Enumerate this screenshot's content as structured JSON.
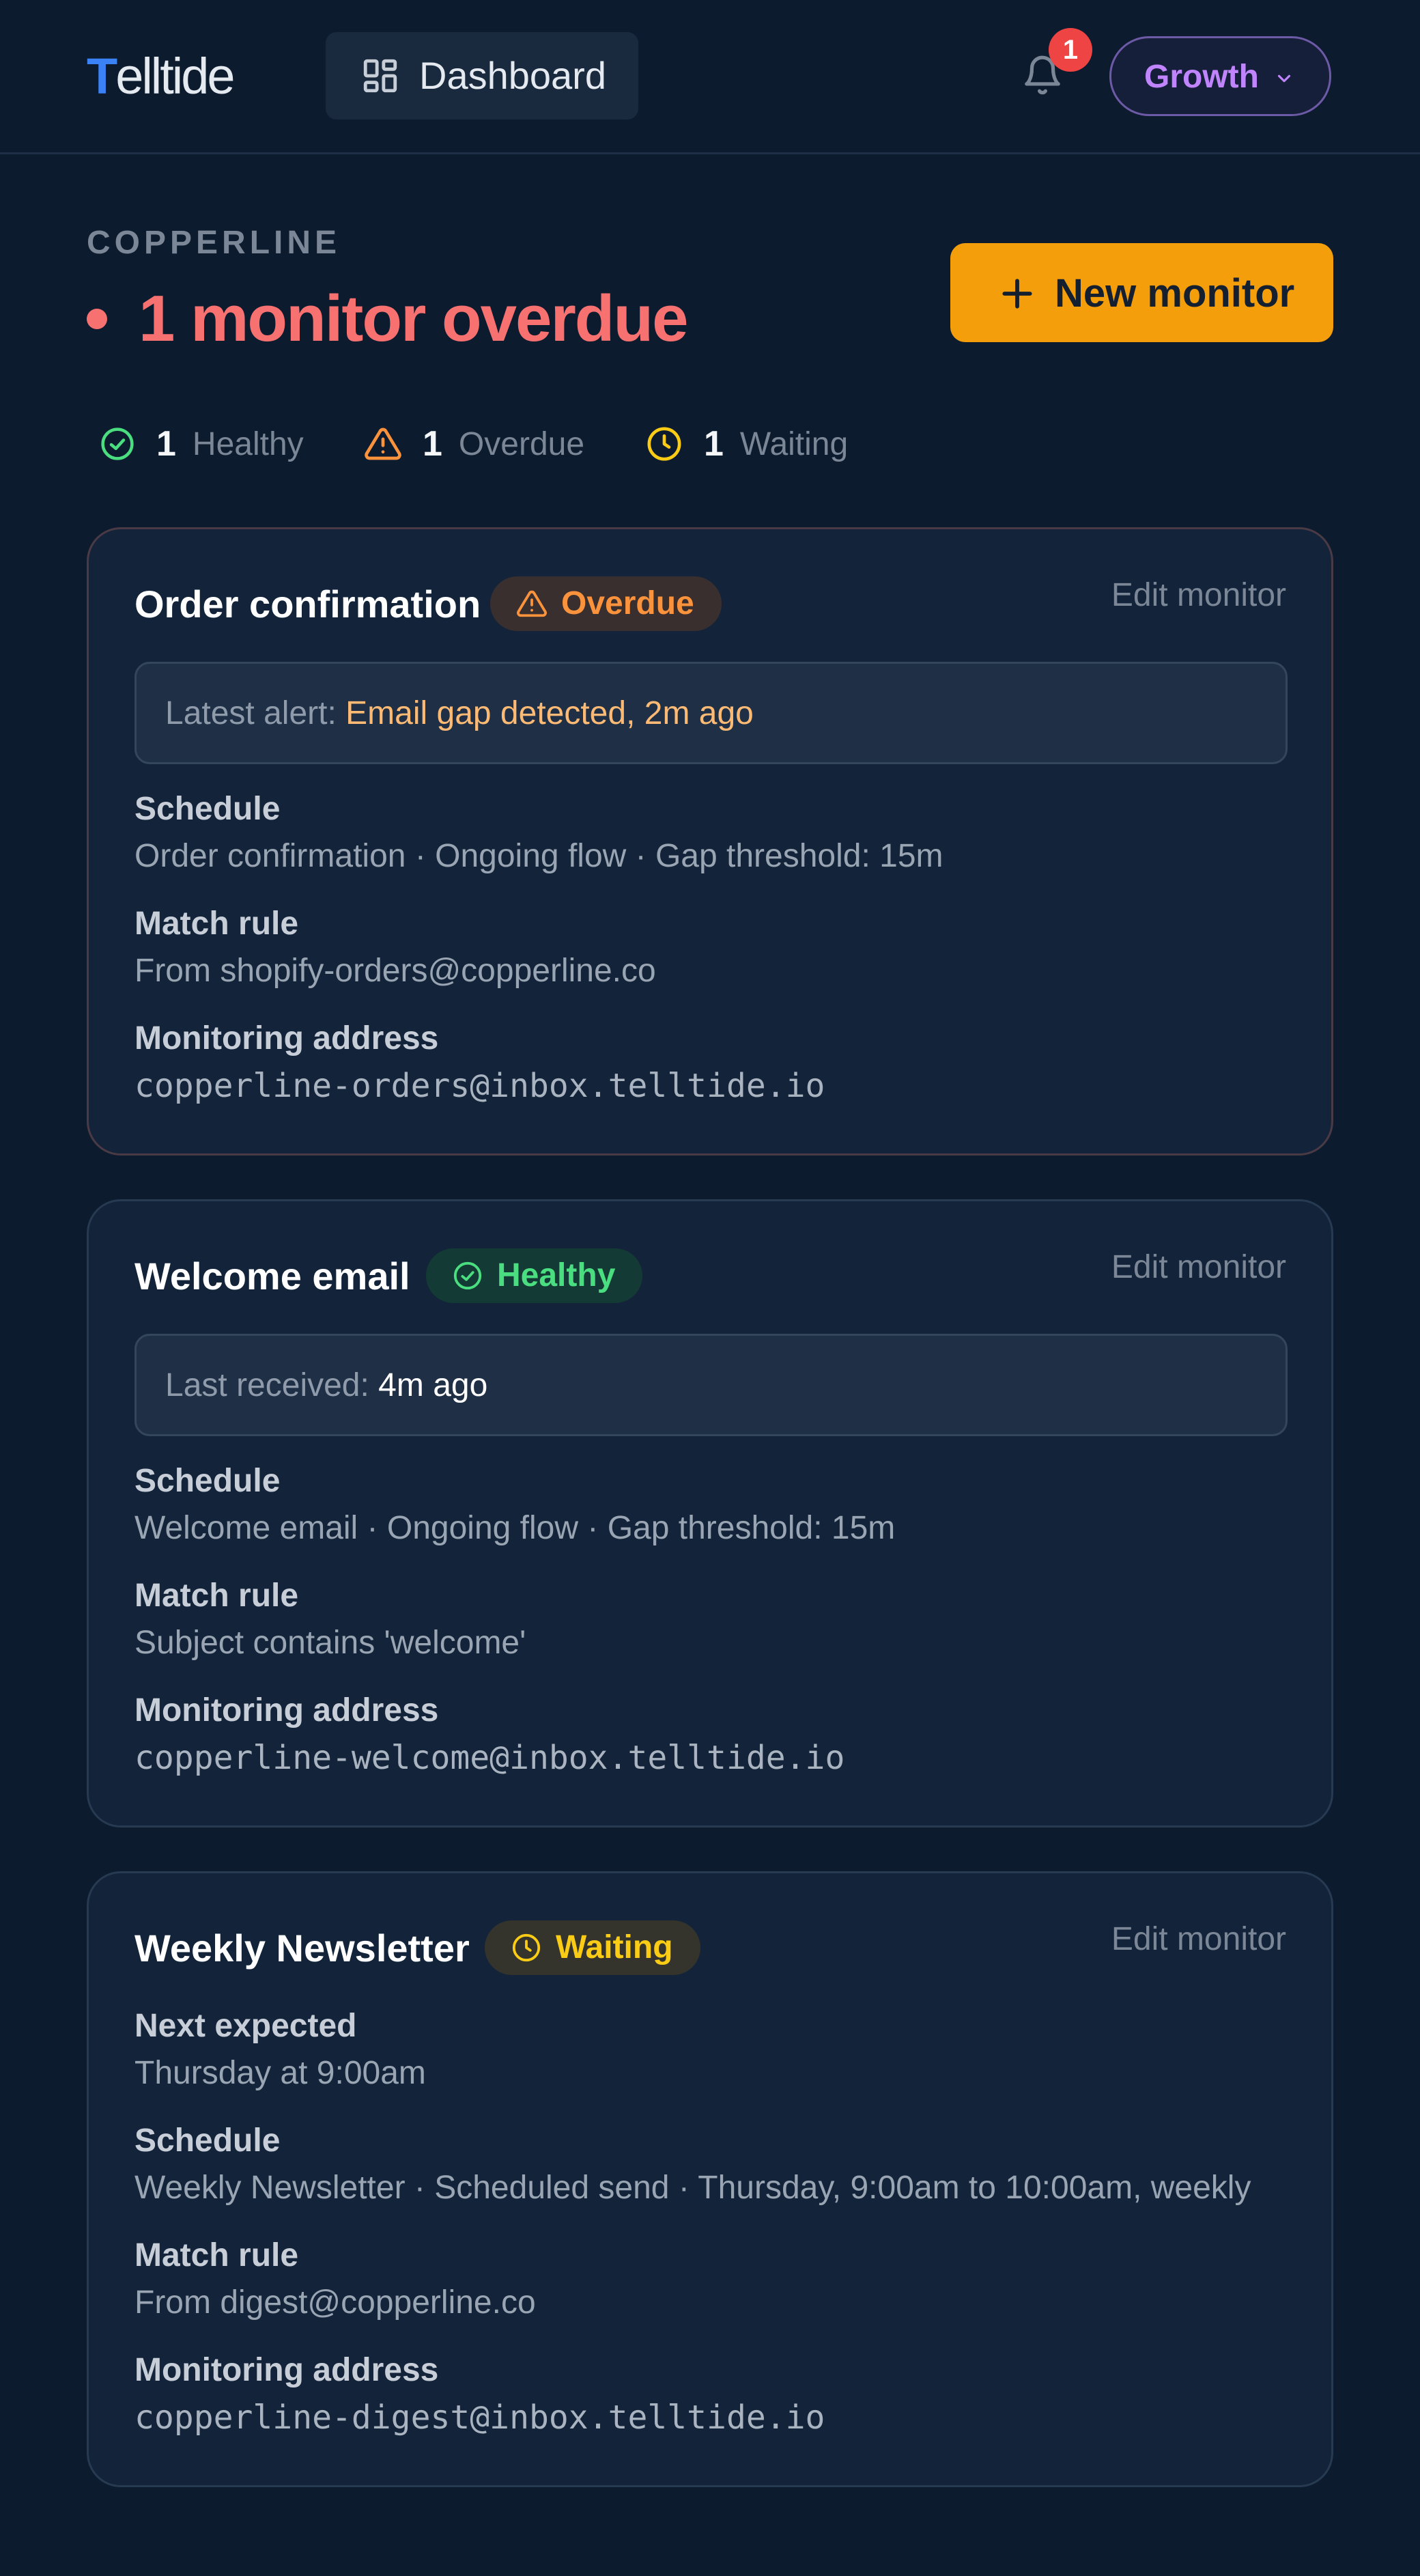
{
  "app": {
    "logo_first": "T",
    "logo_rest": "elltide"
  },
  "nav": {
    "dashboard_label": "Dashboard"
  },
  "notifications": {
    "count": "1"
  },
  "plan": {
    "label": "Growth"
  },
  "header": {
    "org": "COPPERLINE",
    "headline": "1 monitor overdue",
    "new_button": "New monitor"
  },
  "stats": {
    "healthy": {
      "count": "1",
      "label": "Healthy"
    },
    "overdue": {
      "count": "1",
      "label": "Overdue"
    },
    "waiting": {
      "count": "1",
      "label": "Waiting"
    }
  },
  "colors": {
    "healthy": "#4ade80",
    "overdue": "#fb923c",
    "waiting": "#facc15",
    "danger": "#f87171",
    "accent": "#f59e0b"
  },
  "monitors": [
    {
      "title": "Order confirmation",
      "status": "Overdue",
      "edit": "Edit monitor",
      "info_prefix": "Latest alert: ",
      "info_value": "Email gap detected, 2m ago",
      "schedule_label": "Schedule",
      "schedule": "Order confirmation · Ongoing flow · Gap threshold: 15m",
      "match_label": "Match rule",
      "match": "From shopify-orders@copperline.co",
      "address_label": "Monitoring address",
      "address": "copperline-orders@inbox.telltide.io"
    },
    {
      "title": "Welcome email",
      "status": "Healthy",
      "edit": "Edit monitor",
      "info_prefix": "Last received: ",
      "info_value": "4m ago",
      "schedule_label": "Schedule",
      "schedule": "Welcome email · Ongoing flow · Gap threshold: 15m",
      "match_label": "Match rule",
      "match": "Subject contains 'welcome'",
      "address_label": "Monitoring address",
      "address": "copperline-welcome@inbox.telltide.io"
    },
    {
      "title": "Weekly Newsletter",
      "status": "Waiting",
      "edit": "Edit monitor",
      "next_label": "Next expected",
      "next": "Thursday at 9:00am",
      "schedule_label": "Schedule",
      "schedule": "Weekly Newsletter · Scheduled send · Thursday, 9:00am to 10:00am, weekly",
      "match_label": "Match rule",
      "match": "From digest@copperline.co",
      "address_label": "Monitoring address",
      "address": "copperline-digest@inbox.telltide.io"
    }
  ],
  "icons": {
    "dashboard": "grid-icon",
    "notifications": "bell-icon",
    "plan": "chevron-down-icon",
    "new": "plus-icon",
    "healthy": "check-circle-icon",
    "overdue": "warning-triangle-icon",
    "waiting": "clock-icon"
  }
}
